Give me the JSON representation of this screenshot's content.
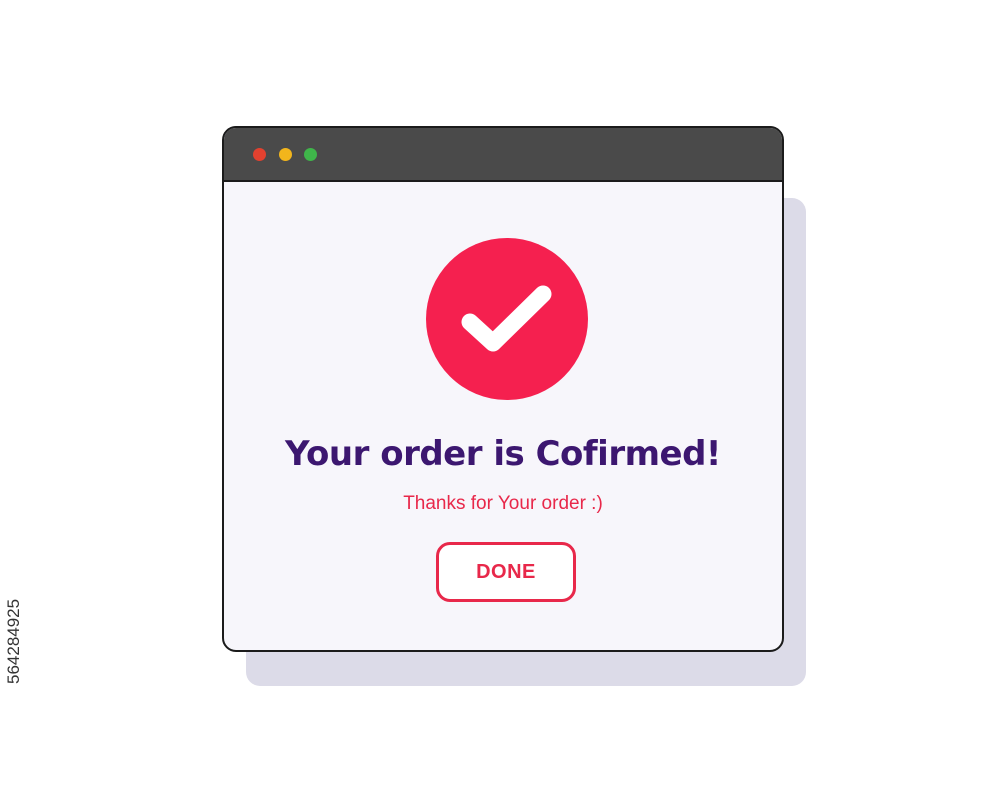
{
  "colors": {
    "accent": "#f5204f",
    "headline": "#3c1770",
    "subline": "#e8284a",
    "title_bar": "#4a4a4a",
    "window_bg": "#f7f6fb",
    "shadow": "#dcdbe8",
    "dot_red": "#e2412f",
    "dot_yellow": "#f2b51c",
    "dot_green": "#3fb54a"
  },
  "window": {
    "title_bar_dots": [
      "red",
      "yellow",
      "green"
    ],
    "status_icon": "check-circle-icon"
  },
  "confirmation": {
    "headline": "Your order is Cofirmed!",
    "subline": "Thanks for Your order :)",
    "done_label": "DONE"
  },
  "watermark": {
    "id_text": "564284925"
  }
}
